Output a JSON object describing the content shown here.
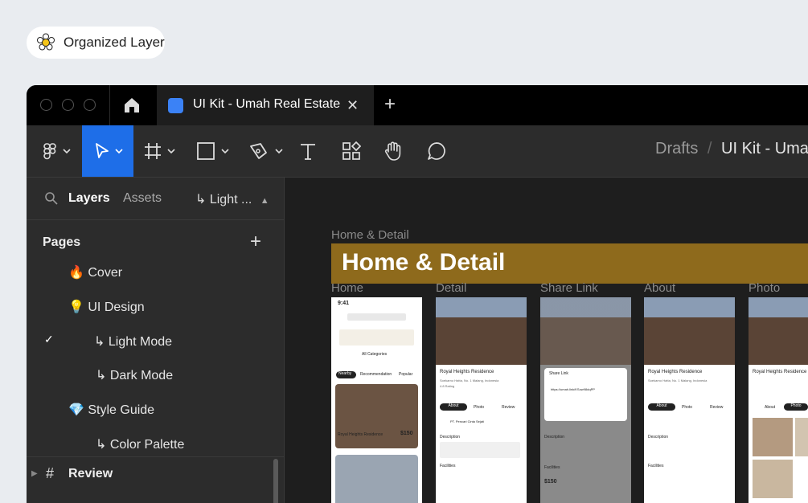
{
  "badge": {
    "label": "Organized Layer",
    "icon": "flower-icon"
  },
  "window": {
    "controls": [
      "close-dot",
      "minimize-dot",
      "maximize-dot"
    ],
    "tab_title": "UI Kit - Umah Real Estate",
    "tab_close": "✕",
    "new_tab": "+"
  },
  "toolbar": {
    "tools": [
      "figma-menu-icon",
      "move-tool-icon",
      "frame-tool-icon",
      "shape-tool-icon",
      "pen-tool-icon",
      "text-tool-icon",
      "resources-icon",
      "hand-tool-icon",
      "comment-icon"
    ],
    "active_tool": "move-tool-icon",
    "accent": "#1e6ee8"
  },
  "breadcrumb": {
    "root": "Drafts",
    "sep": "/",
    "current": "UI Kit - Uma"
  },
  "sidebar": {
    "tab_layers": "Layers",
    "tab_assets": "Assets",
    "page_picker": "↳ Light ...",
    "pages_title": "Pages",
    "pages_add": "+",
    "pages": [
      {
        "label": "🔥 Cover"
      },
      {
        "label": "💡 UI Design"
      },
      {
        "label": "↳ Light Mode",
        "selected": true
      },
      {
        "label": "↳ Dark Mode"
      },
      {
        "label": "💎 Style Guide"
      },
      {
        "label": "↳ Color Palette"
      }
    ],
    "check": "✓",
    "bottom_layer": "Review"
  },
  "canvas": {
    "section_label": "Home & Detail",
    "banner_title": "Home & Detail",
    "banner_color": "#8e6a1c",
    "frames": [
      {
        "label": "Home"
      },
      {
        "label": "Detail"
      },
      {
        "label": "Share Link"
      },
      {
        "label": "About"
      },
      {
        "label": "Photo"
      }
    ],
    "mock": {
      "time": "9:41",
      "listing": "Royal Heights Residence",
      "address": "Soekarno Hatta, No. 1 Malang, Indonesia",
      "rating": "4.8 Rating",
      "price": "$150",
      "share_title": "Share Link",
      "share_url": "https://umah.link/KSow98dqPP",
      "agent": "PT. Pencari Cinta Sejati",
      "description": "Description",
      "facilities": "Facilities",
      "tabs": [
        "About",
        "Photo",
        "Review"
      ],
      "home_tabs": [
        "Nearby",
        "Recommendation",
        "Popular"
      ],
      "all_categories": "All Categories"
    }
  }
}
